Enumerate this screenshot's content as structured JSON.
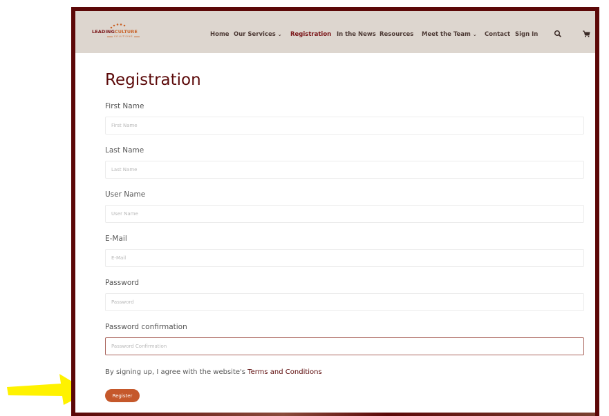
{
  "brand": {
    "logo_main": "LEADING",
    "logo_accent": "CULTURE",
    "logo_sub": "SOLUTIONS"
  },
  "nav": {
    "home": "Home",
    "services": "Our Services",
    "registration": "Registration",
    "news": "In the News",
    "resources": "Resources",
    "team": "Meet the Team",
    "contact": "Contact",
    "signin": "Sign In",
    "search_icon": "search-icon",
    "cart_icon": "cart-icon"
  },
  "page": {
    "title": "Registration"
  },
  "form": {
    "first_name": {
      "label": "First Name",
      "placeholder": "First Name",
      "value": ""
    },
    "last_name": {
      "label": "Last Name",
      "placeholder": "Last Name",
      "value": ""
    },
    "user_name": {
      "label": "User Name",
      "placeholder": "User Name",
      "value": ""
    },
    "email": {
      "label": "E-Mail",
      "placeholder": "E-Mail",
      "value": ""
    },
    "password": {
      "label": "Password",
      "placeholder": "Password",
      "value": ""
    },
    "password_confirmation": {
      "label": "Password confirmation",
      "placeholder": "Password Confirmation",
      "value": ""
    },
    "agree_text": "By signing up, I agree with the website's ",
    "terms_link": "Terms and Conditions",
    "register_label": "Register"
  },
  "colors": {
    "frame": "#5c0808",
    "navbar_bg": "#ddd6cf",
    "title": "#5c0a0a",
    "button": "#c5582b",
    "arrow": "#fff200"
  }
}
